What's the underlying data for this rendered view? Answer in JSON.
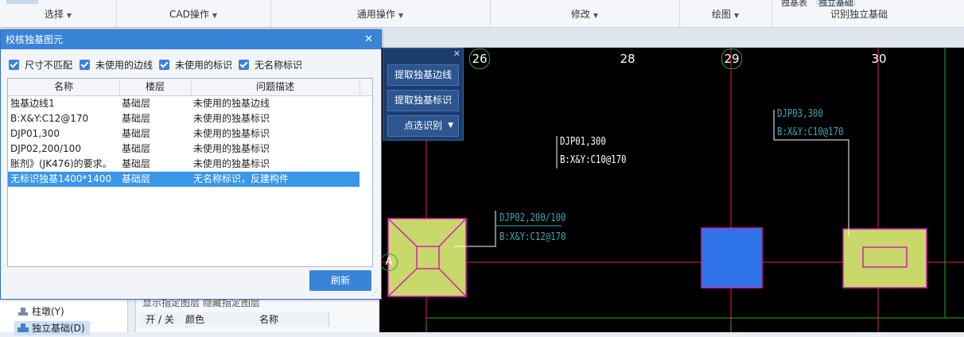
{
  "ribbon": {
    "groups": [
      {
        "label": "选择"
      },
      {
        "label": "CAD操作"
      },
      {
        "label": "通用操作"
      },
      {
        "label": "修改"
      },
      {
        "label": "绘图"
      },
      {
        "label": "识别独立基础"
      }
    ],
    "top_texts": [
      "独基表",
      "独立基础"
    ]
  },
  "dialog": {
    "title": "校核独基图元",
    "checkboxes": [
      {
        "label": "尺寸不匹配",
        "checked": true
      },
      {
        "label": "未使用的边线",
        "checked": true
      },
      {
        "label": "未使用的标识",
        "checked": true
      },
      {
        "label": "无名称标识",
        "checked": true
      }
    ],
    "columns": [
      "名称",
      "楼层",
      "问题描述"
    ],
    "rows": [
      {
        "name": "独基边线1",
        "floor": "基础层",
        "desc": "未使用的独基边线"
      },
      {
        "name": "B:X&Y:C12@170",
        "floor": "基础层",
        "desc": "未使用的独基标识"
      },
      {
        "name": "DJP01,300",
        "floor": "基础层",
        "desc": "未使用的独基标识"
      },
      {
        "name": "DJP02,200/100",
        "floor": "基础层",
        "desc": "未使用的独基标识"
      },
      {
        "name": "胀剂》(JK476)的要求。",
        "floor": "基础层",
        "desc": "未使用的独基标识"
      },
      {
        "name": "无标识独基1400*1400",
        "floor": "基础层",
        "desc": "无名称标识，反建构件",
        "selected": true
      }
    ],
    "refresh_label": "刷新"
  },
  "float_toolbar": {
    "buttons": [
      "提取独基边线",
      "提取独基标识",
      "点选识别"
    ]
  },
  "canvas": {
    "axis_labels": [
      "26",
      "28",
      "29",
      "30",
      "A"
    ],
    "annotations": {
      "djp01_name": "DJP01,300",
      "djp01_rebar": "B:X&Y:C10@170",
      "djp02_name": "DJP02,200/100",
      "djp02_rebar": "B:X&Y:C12@170",
      "djp03_name": "DJP03,300",
      "djp03_rebar": "B:X&Y:C10@170"
    }
  },
  "left_tree": {
    "items": [
      {
        "label": "柱墩(Y)"
      },
      {
        "label": "独立基础(D)",
        "selected": true
      }
    ]
  },
  "layer_panel": {
    "header_text": "显示指定图层   隐藏指定图层",
    "columns": [
      "开 / 关",
      "颜色",
      "名称"
    ]
  },
  "colors": {
    "accent": "#3a84d8",
    "selected_row": "#3a96e6",
    "canvas_bg": "#000000",
    "footing_fill": "#c8d86a",
    "footing_blue": "#2f73e8",
    "axis_red": "#e0204a"
  }
}
